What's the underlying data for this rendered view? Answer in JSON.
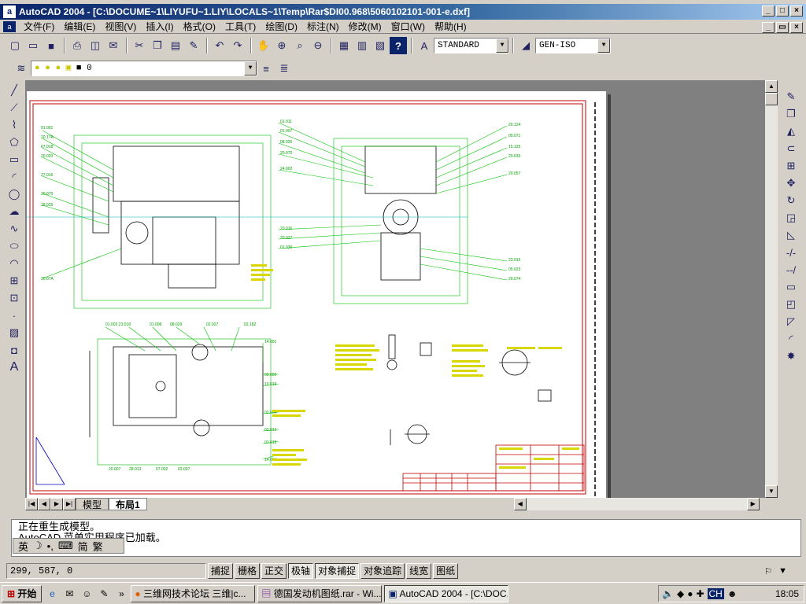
{
  "window": {
    "app_icon": "a",
    "title": "AutoCAD 2004 - [C:\\DOCUME~1\\LIYUFU~1.LIY\\LOCALS~1\\Temp\\Rar$DI00.968\\5060102101-001-e.dxf]",
    "controls": [
      "_",
      "□",
      "×"
    ],
    "mdi_controls": [
      "_",
      "▭",
      "×"
    ]
  },
  "menubar": {
    "items": [
      "文件(F)",
      "编辑(E)",
      "视图(V)",
      "插入(I)",
      "格式(O)",
      "工具(T)",
      "绘图(D)",
      "标注(N)",
      "修改(M)",
      "窗口(W)",
      "帮助(H)"
    ]
  },
  "toolbar_std": {
    "text_style": "STANDARD",
    "dim_style": "GEN-ISO",
    "icons": [
      "new-icon",
      "open-icon",
      "save-icon",
      "print-icon",
      "preview-icon",
      "plot-icon",
      "cut-icon",
      "copy-icon",
      "paste-icon",
      "matchprop-icon",
      "undo-icon",
      "redo-icon",
      "pan-icon",
      "zoom-realtime-icon",
      "zoom-window-icon",
      "zoom-previous-icon",
      "properties-icon",
      "designcenter-icon",
      "toolpalettes-icon",
      "help-icon"
    ]
  },
  "toolbar_layer": {
    "layer_name": "0"
  },
  "draw_tools": [
    "line",
    "xline",
    "polyline",
    "polygon",
    "rectangle",
    "arc",
    "circle",
    "revcloud",
    "spline",
    "ellipse",
    "ellipse-arc",
    "insert-block",
    "make-block",
    "point",
    "hatch",
    "region",
    "mtext"
  ],
  "modify_tools": [
    "erase",
    "copy",
    "mirror",
    "offset",
    "array",
    "move",
    "rotate",
    "scale",
    "stretch",
    "trim",
    "extend",
    "break",
    "chamfer",
    "fillet",
    "explode"
  ],
  "layout_tabs": {
    "model": "模型",
    "layout1": "布局1",
    "active": "layout1"
  },
  "command_line": {
    "line1": "正在重生成模型。",
    "line2": "AutoCAD 菜单实用程序已加载。"
  },
  "ime": {
    "label": "英",
    "mode": "简",
    "extra": "繁"
  },
  "status": {
    "coords": "299, 587, 0",
    "toggles": [
      {
        "label": "捕捉",
        "on": false
      },
      {
        "label": "栅格",
        "on": false
      },
      {
        "label": "正交",
        "on": false
      },
      {
        "label": "极轴",
        "on": true
      },
      {
        "label": "对象捕捉",
        "on": true
      },
      {
        "label": "对象追踪",
        "on": false
      },
      {
        "label": "线宽",
        "on": false
      },
      {
        "label": "图纸",
        "on": false
      }
    ]
  },
  "taskbar": {
    "start": "开始",
    "tasks": [
      {
        "label": "三维网技术论坛 三维|c...",
        "active": false
      },
      {
        "label": "德国发动机图纸.rar - Wi...",
        "active": false
      },
      {
        "label": "AutoCAD 2004 - [C:\\DOC...",
        "active": true
      }
    ],
    "tray_lang": "CH",
    "clock": "18:05"
  },
  "colors": {
    "title_bar": "#0a246a",
    "drawing_green": "#00c000",
    "drawing_yellow": "#d8d800",
    "drawing_red": "#c00000",
    "drawing_cyan": "#00b0c0"
  }
}
